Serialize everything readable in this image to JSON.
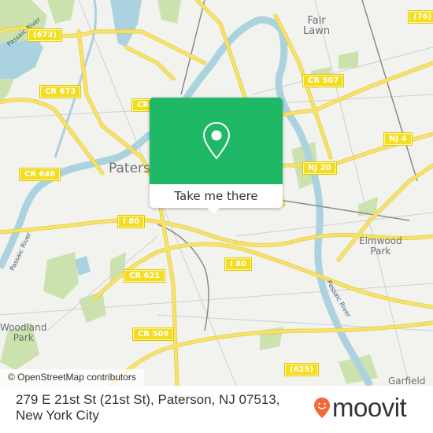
{
  "map": {
    "place_labels": [
      {
        "text": "Fair Lawn",
        "lines": [
          "Fair",
          "Lawn"
        ]
      },
      {
        "text": "Paterson",
        "lines": [
          "Paters"
        ]
      },
      {
        "text": "Elmwood Park",
        "lines": [
          "Elmwood",
          "Park"
        ]
      },
      {
        "text": "Woodland Park",
        "lines": [
          "Woodland",
          "Park"
        ]
      },
      {
        "text": "Garfield",
        "lines": [
          "Garfield"
        ]
      }
    ],
    "road_shields": [
      "(673)",
      "CR 673",
      "CR",
      "CR 646",
      "(76)",
      "CR 507",
      "NJ 4",
      "NJ 20",
      "I 80",
      "I 80",
      "CR 621",
      "CR 509",
      "(625)"
    ],
    "river_labels": [
      "Passaic River",
      "Passaic River",
      "Passaic River"
    ],
    "colors": {
      "water": "#aad3df",
      "road": "#f7e26b",
      "road_edge": "#e8cc3c",
      "park": "#c8e1a8",
      "land": "#f2f2ef"
    }
  },
  "popup": {
    "icon": "map-pin-icon",
    "button_label": "Take me there",
    "color": "#1fb866"
  },
  "attribution": "© OpenStreetMap contributors",
  "footer": {
    "address": "279 E 21st St (21st St), Paterson, NJ 07513, New York City",
    "brand": "moovit",
    "brand_color": "#f26a35"
  }
}
